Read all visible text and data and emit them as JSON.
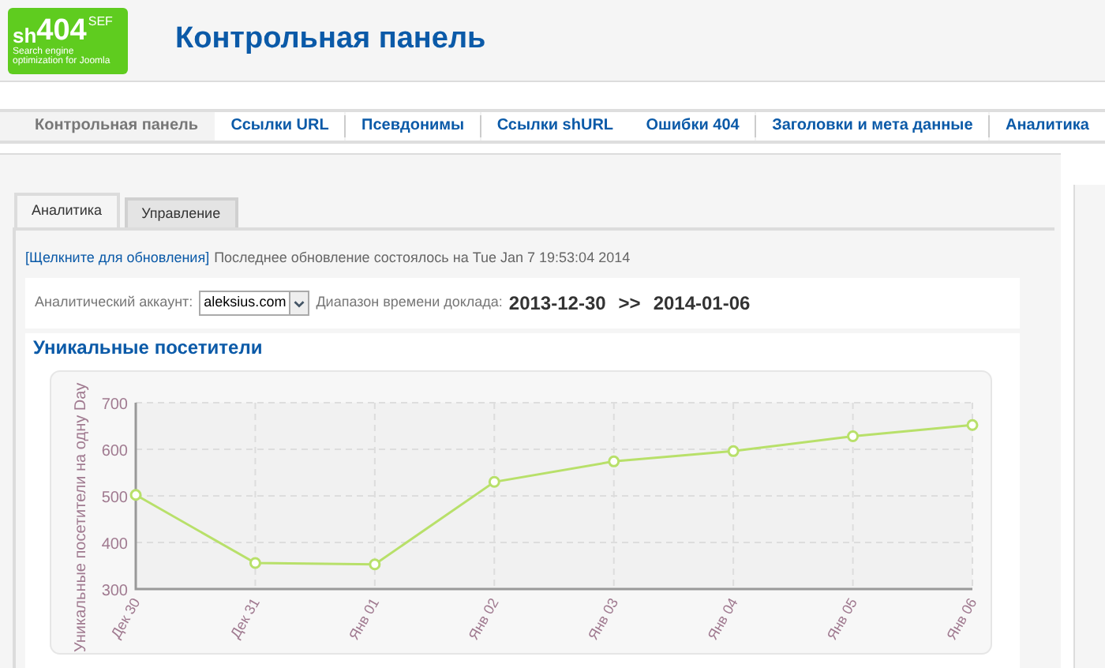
{
  "logo": {
    "brand": "sh",
    "number": "404",
    "suffix": "SEF",
    "tagline": "Search engine optimization for Joomla"
  },
  "page_title": "Контрольная панель",
  "nav": [
    {
      "label": "Контрольная панель",
      "selected": true
    },
    {
      "label": "Ссылки URL",
      "selected": false
    },
    {
      "label": "Псевдонимы",
      "selected": false
    },
    {
      "label": "Ссылки shURL",
      "selected": false
    },
    {
      "label": "Ошибки 404",
      "selected": false
    },
    {
      "label": "Заголовки и мета данные",
      "selected": false
    },
    {
      "label": "Аналитика",
      "selected": false
    }
  ],
  "tabs": [
    {
      "label": "Аналитика",
      "selected": true
    },
    {
      "label": "Управление",
      "selected": false
    }
  ],
  "refresh_link": "[Щелкните для обновления]",
  "last_update": "Последнее обновление состоялось на Tue Jan 7 19:53:04 2014",
  "account_label": "Аналитический аккаунт:",
  "account_value": "aleksius.com",
  "range_label": "Диапазон времени доклада:",
  "range_start": "2013-12-30",
  "range_sep": ">>",
  "range_end": "2014-01-06",
  "chart_title": "Уникальные посетители",
  "chart_data": {
    "type": "line",
    "ylabel": "Уникальные посетители на одну Day",
    "categories": [
      "Дек 30",
      "Дек 31",
      "Янв 01",
      "Янв 02",
      "Янв 03",
      "Янв 04",
      "Янв 05",
      "Янв 06"
    ],
    "ylim": [
      300,
      700
    ],
    "yticks": [
      300,
      400,
      500,
      600,
      700
    ],
    "grid": true,
    "series": [
      {
        "color": "#b8e06a",
        "marker": "circle",
        "values": [
          502,
          356,
          353,
          530,
          574,
          596,
          628,
          652
        ]
      }
    ]
  }
}
